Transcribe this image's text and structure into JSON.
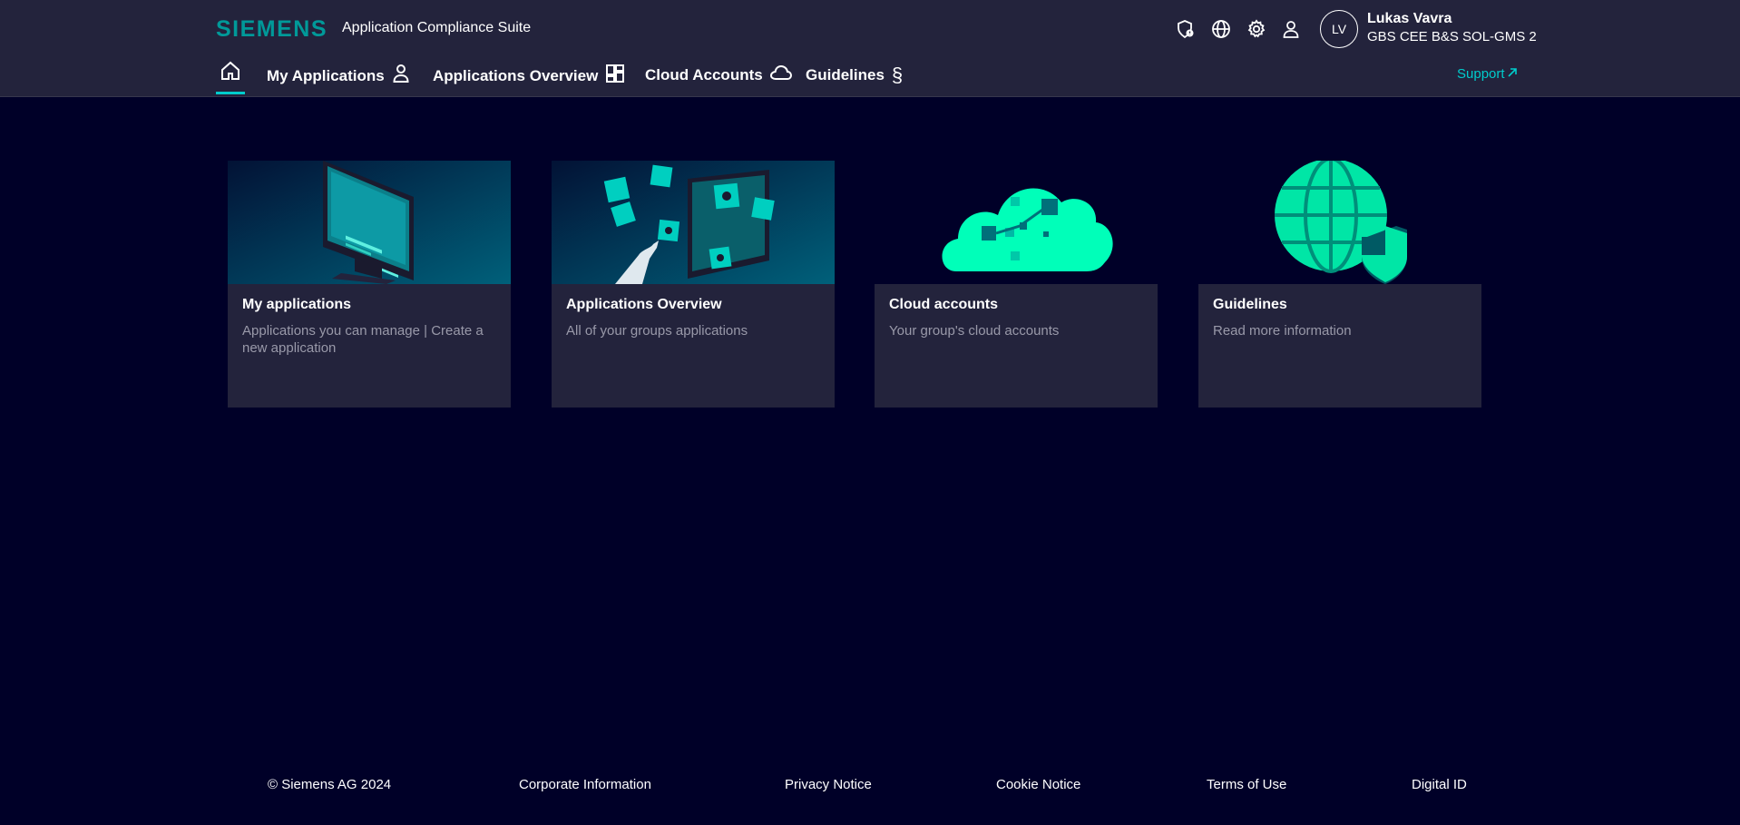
{
  "header": {
    "logo": "SIEMENS",
    "app_title": "Application Compliance Suite",
    "utility_icons": [
      "shield-icon",
      "globe-icon",
      "gear-icon",
      "user-icon"
    ],
    "user": {
      "initials": "LV",
      "name": "Lukas Vavra",
      "org": "GBS CEE B&S SOL-GMS 2"
    }
  },
  "nav": {
    "home_icon": "home-icon",
    "items": [
      {
        "label": "My Applications",
        "icon": "user-icon"
      },
      {
        "label": "Applications Overview",
        "icon": "dashboard-icon"
      },
      {
        "label": "Cloud Accounts",
        "icon": "cloud-icon"
      },
      {
        "label": "Guidelines",
        "icon": "section-sign-icon"
      }
    ],
    "support": "Support"
  },
  "cards": [
    {
      "title": "My applications",
      "description": "Applications you can manage | Create a new application"
    },
    {
      "title": "Applications Overview",
      "description": "All of your groups applications"
    },
    {
      "title": "Cloud accounts",
      "description": "Your group's cloud accounts"
    },
    {
      "title": "Guidelines",
      "description": "Read more information"
    }
  ],
  "footer": {
    "copyright": "© Siemens AG 2024",
    "links": [
      "Corporate Information",
      "Privacy Notice",
      "Cookie Notice",
      "Terms of Use",
      "Digital ID"
    ]
  },
  "colors": {
    "background": "#000028",
    "header": "#23233c",
    "accent": "#00cccc",
    "brand": "#009999",
    "illustration": "#00ffb9"
  }
}
